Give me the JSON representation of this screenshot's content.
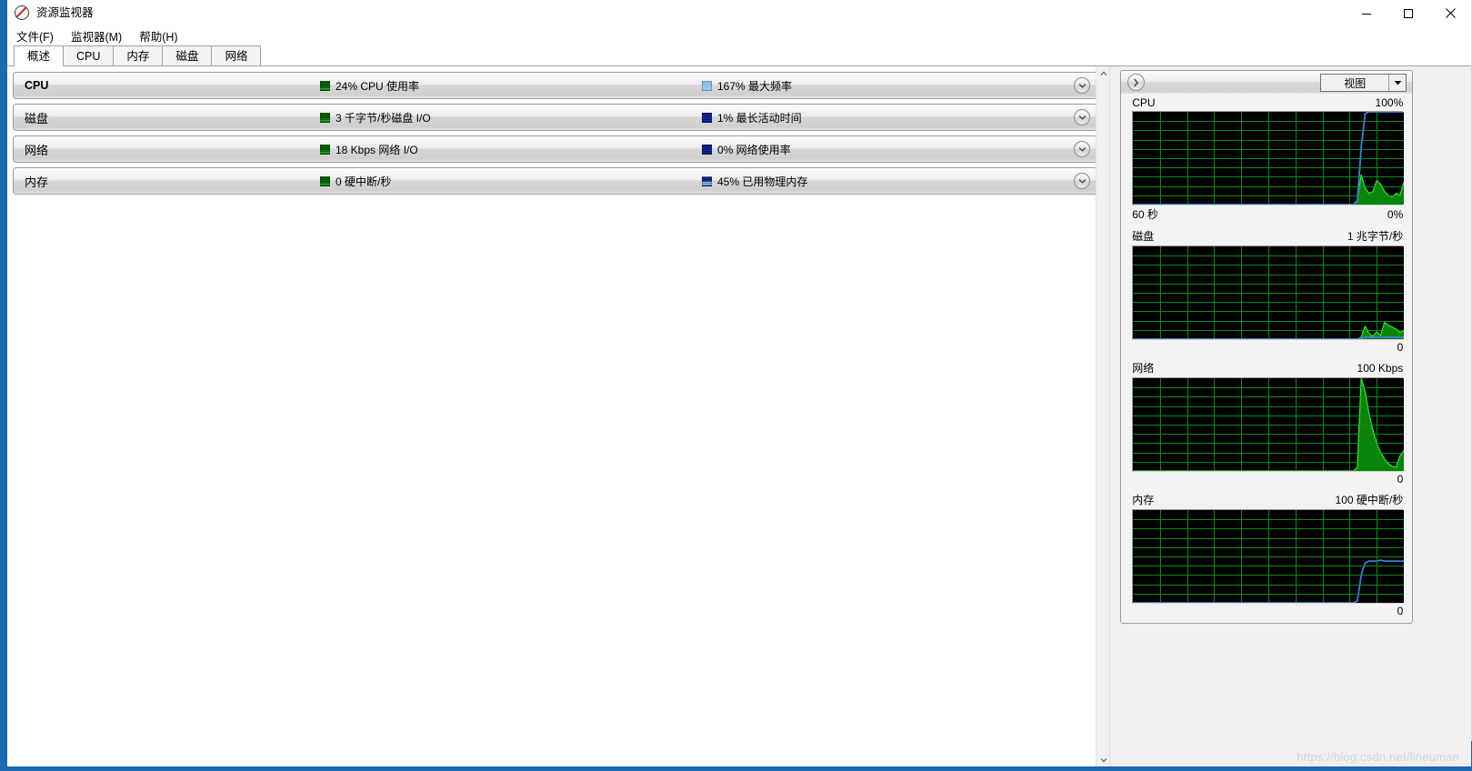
{
  "window": {
    "title": "资源监视器",
    "icon": "resource-monitor-icon",
    "minimize_label": "最小化",
    "maximize_label": "最大化",
    "close_label": "关闭"
  },
  "menu": {
    "items": [
      {
        "label": "文件(F)",
        "name": "menu-file"
      },
      {
        "label": "监视器(M)",
        "name": "menu-monitor"
      },
      {
        "label": "帮助(H)",
        "name": "menu-help"
      }
    ]
  },
  "tabs": [
    {
      "label": "概述",
      "active": true
    },
    {
      "label": "CPU",
      "active": false
    },
    {
      "label": "内存",
      "active": false
    },
    {
      "label": "磁盘",
      "active": false
    },
    {
      "label": "网络",
      "active": false
    }
  ],
  "resource_rows": [
    {
      "name": "CPU",
      "bold": true,
      "metric1": "24% CPU 使用率",
      "metric1_swatch": "green",
      "metric2": "167% 最大频率",
      "metric2_swatch": "lightblue"
    },
    {
      "name": "磁盘",
      "bold": false,
      "metric1": "3 千字节/秒磁盘 I/O",
      "metric1_swatch": "green",
      "metric2": "1% 最长活动时间",
      "metric2_swatch": "darkblue"
    },
    {
      "name": "网络",
      "bold": false,
      "metric1": "18 Kbps 网络 I/O",
      "metric1_swatch": "green",
      "metric2": "0% 网络使用率",
      "metric2_swatch": "darkblue"
    },
    {
      "name": "内存",
      "bold": false,
      "metric1": "0 硬中断/秒",
      "metric1_swatch": "green",
      "metric2": "45% 已用物理内存",
      "metric2_swatch": "blue-split"
    }
  ],
  "side_panel": {
    "view_label": "视图",
    "collapse_icon": "chevron-right-icon",
    "dropdown_icon": "chevron-down-icon"
  },
  "colors": {
    "graph_background": "#000000",
    "graph_grid": "#0c8a18",
    "series_green_line": "#2fe02f",
    "series_green_fill": "#0a8a0a",
    "series_blue_line": "#3a7fe0",
    "title_bar": "#ffffff",
    "window_chrome": "#f0f0f0",
    "desktop_accent": "#1b69b0"
  },
  "watermark": "https://blog.csdn.net/lineuman",
  "chart_data": [
    {
      "id": "cpu-graph",
      "type": "area",
      "title": "CPU",
      "scale_top_label": "100%",
      "scale_bottom_label": "0%",
      "time_label": "60 秒",
      "ylim": [
        0,
        100
      ],
      "grid": true,
      "grid_cols": 10,
      "grid_rows": 10,
      "series": [
        {
          "name": "CPU 使用率",
          "color": "#2fe02f",
          "fill": "#0a8a0a",
          "values": [
            0,
            0,
            0,
            0,
            0,
            0,
            0,
            0,
            0,
            0,
            0,
            0,
            0,
            0,
            0,
            0,
            0,
            0,
            0,
            0,
            0,
            0,
            0,
            0,
            0,
            0,
            0,
            0,
            0,
            0,
            0,
            0,
            0,
            0,
            0,
            0,
            0,
            0,
            0,
            0,
            0,
            0,
            0,
            0,
            0,
            0,
            0,
            0,
            0,
            0,
            0,
            0,
            0,
            0,
            0,
            0,
            0,
            0,
            5,
            32,
            18,
            12,
            14,
            26,
            22,
            14,
            10,
            8,
            12,
            10,
            24
          ]
        },
        {
          "name": "最大频率",
          "color": "#3a7fe0",
          "fill": "none",
          "values": [
            0,
            0,
            0,
            0,
            0,
            0,
            0,
            0,
            0,
            0,
            0,
            0,
            0,
            0,
            0,
            0,
            0,
            0,
            0,
            0,
            0,
            0,
            0,
            0,
            0,
            0,
            0,
            0,
            0,
            0,
            0,
            0,
            0,
            0,
            0,
            0,
            0,
            0,
            0,
            0,
            0,
            0,
            0,
            0,
            0,
            0,
            0,
            0,
            0,
            0,
            0,
            0,
            0,
            0,
            0,
            0,
            0,
            0,
            4,
            62,
            98,
            100,
            100,
            100,
            100,
            100,
            100,
            100,
            100,
            100,
            100
          ]
        }
      ]
    },
    {
      "id": "disk-graph",
      "type": "area",
      "title": "磁盘",
      "scale_top_label": "1 兆字节/秒",
      "scale_bottom_label": "0",
      "ylim": [
        0,
        100
      ],
      "grid": true,
      "grid_cols": 10,
      "grid_rows": 10,
      "series": [
        {
          "name": "磁盘 I/O",
          "color": "#2fe02f",
          "fill": "#0a8a0a",
          "values": [
            0,
            0,
            0,
            0,
            0,
            0,
            0,
            0,
            0,
            0,
            0,
            0,
            0,
            0,
            0,
            0,
            0,
            0,
            0,
            0,
            0,
            0,
            0,
            0,
            0,
            0,
            0,
            0,
            0,
            0,
            0,
            0,
            0,
            0,
            0,
            0,
            0,
            0,
            0,
            0,
            0,
            0,
            0,
            0,
            0,
            0,
            0,
            0,
            0,
            0,
            0,
            0,
            0,
            0,
            0,
            0,
            0,
            0,
            0,
            2,
            14,
            6,
            3,
            8,
            4,
            18,
            15,
            13,
            11,
            7,
            9
          ]
        },
        {
          "name": "最长活动时间",
          "color": "#3a7fe0",
          "fill": "none",
          "values": [
            0,
            0,
            0,
            0,
            0,
            0,
            0,
            0,
            0,
            0,
            0,
            0,
            0,
            0,
            0,
            0,
            0,
            0,
            0,
            0,
            0,
            0,
            0,
            0,
            0,
            0,
            0,
            0,
            0,
            0,
            0,
            0,
            0,
            0,
            0,
            0,
            0,
            0,
            0,
            0,
            0,
            0,
            0,
            0,
            0,
            0,
            0,
            0,
            0,
            0,
            0,
            0,
            0,
            0,
            0,
            0,
            0,
            0,
            0,
            1,
            2,
            2,
            2,
            2,
            2,
            2,
            2,
            2,
            2,
            2,
            2
          ]
        }
      ]
    },
    {
      "id": "network-graph",
      "type": "area",
      "title": "网络",
      "scale_top_label": "100 Kbps",
      "scale_bottom_label": "0",
      "ylim": [
        0,
        100
      ],
      "grid": true,
      "grid_cols": 10,
      "grid_rows": 10,
      "series": [
        {
          "name": "网络 I/O",
          "color": "#2fe02f",
          "fill": "#0a8a0a",
          "values": [
            0,
            0,
            0,
            0,
            0,
            0,
            0,
            0,
            0,
            0,
            0,
            0,
            0,
            0,
            0,
            0,
            0,
            0,
            0,
            0,
            0,
            0,
            0,
            0,
            0,
            0,
            0,
            0,
            0,
            0,
            0,
            0,
            0,
            0,
            0,
            0,
            0,
            0,
            0,
            0,
            0,
            0,
            0,
            0,
            0,
            0,
            0,
            0,
            0,
            0,
            0,
            0,
            0,
            0,
            0,
            0,
            0,
            0,
            4,
            100,
            86,
            62,
            44,
            30,
            20,
            13,
            8,
            5,
            4,
            16,
            22
          ]
        }
      ]
    },
    {
      "id": "memory-graph",
      "type": "line",
      "title": "内存",
      "scale_top_label": "100 硬中断/秒",
      "scale_bottom_label": "0",
      "ylim": [
        0,
        100
      ],
      "grid": true,
      "grid_cols": 10,
      "grid_rows": 10,
      "series": [
        {
          "name": "硬中断/秒",
          "color": "#3a7fe0",
          "fill": "none",
          "values": [
            0,
            0,
            0,
            0,
            0,
            0,
            0,
            0,
            0,
            0,
            0,
            0,
            0,
            0,
            0,
            0,
            0,
            0,
            0,
            0,
            0,
            0,
            0,
            0,
            0,
            0,
            0,
            0,
            0,
            0,
            0,
            0,
            0,
            0,
            0,
            0,
            0,
            0,
            0,
            0,
            0,
            0,
            0,
            0,
            0,
            0,
            0,
            0,
            0,
            0,
            0,
            0,
            0,
            0,
            0,
            0,
            0,
            0,
            2,
            30,
            43,
            45,
            45,
            45,
            46,
            45,
            45,
            45,
            45,
            45,
            45
          ]
        }
      ]
    }
  ]
}
